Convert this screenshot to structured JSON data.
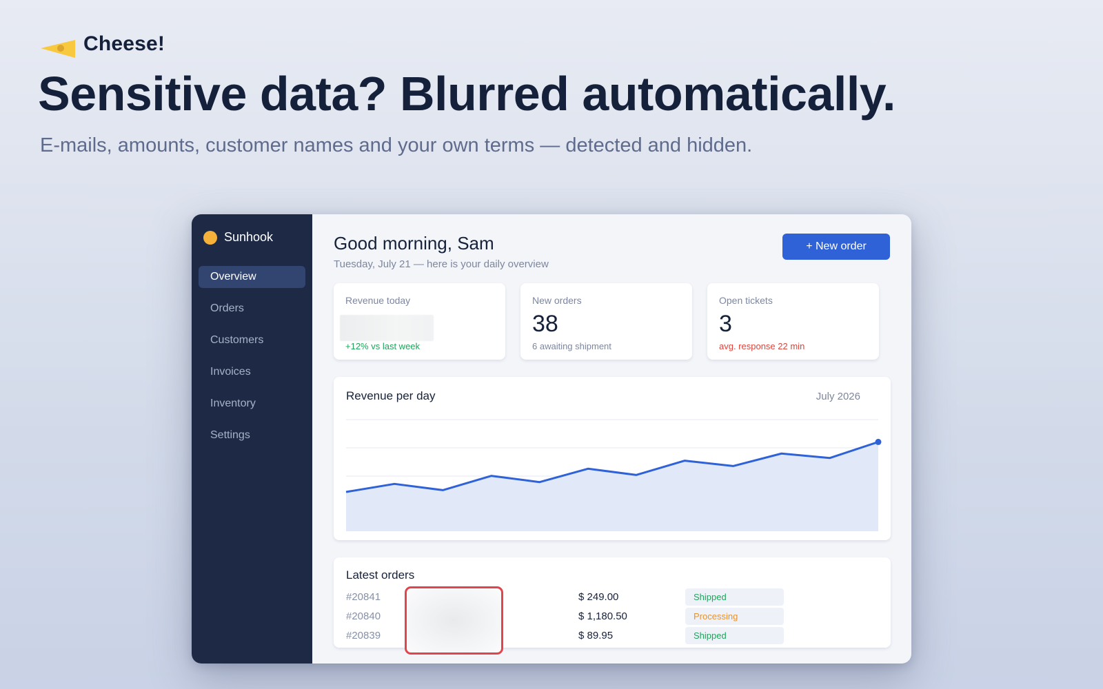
{
  "brand": {
    "name": "Cheese!",
    "logo_icon": "cheese-wedge-icon",
    "logo_color": "#f8c93f"
  },
  "hero": {
    "title": "Sensitive data? Blurred automatically.",
    "subtitle": "E-mails, amounts, customer names and your own terms — detected and hidden."
  },
  "app": {
    "name": "Sunhook",
    "logo_color": "#f6b13b",
    "nav": [
      {
        "label": "Overview",
        "active": true
      },
      {
        "label": "Orders",
        "active": false
      },
      {
        "label": "Customers",
        "active": false
      },
      {
        "label": "Invoices",
        "active": false
      },
      {
        "label": "Inventory",
        "active": false
      },
      {
        "label": "Settings",
        "active": false
      }
    ],
    "greeting": "Good morning, Sam",
    "date_line": "Tuesday, July 21 — here is your daily overview",
    "new_order_label": "+ New order",
    "stats": [
      {
        "label": "Revenue today",
        "value": "",
        "note": "+12% vs last week",
        "note_color": "#1fa35c",
        "blurred": true
      },
      {
        "label": "New orders",
        "value": "38",
        "note": "6 awaiting shipment",
        "note_color": "#7c869e",
        "blurred": false
      },
      {
        "label": "Open tickets",
        "value": "3",
        "note": "avg. response 22 min",
        "note_color": "#d9453c",
        "blurred": false
      }
    ],
    "chart": {
      "title": "Revenue per day",
      "period": "July 2026"
    },
    "orders": {
      "title": "Latest orders",
      "rows": [
        {
          "id": "#20841",
          "amount": "$ 249.00",
          "status": "Shipped",
          "status_color": "#1fa35c"
        },
        {
          "id": "#20840",
          "amount": "$ 1,180.50",
          "status": "Processing",
          "status_color": "#e8922d"
        },
        {
          "id": "#20839",
          "amount": "$ 89.95",
          "status": "Shipped",
          "status_color": "#1fa35c"
        }
      ]
    }
  },
  "chart_data": {
    "type": "area",
    "title": "Revenue per day",
    "x": [
      1,
      2,
      3,
      4,
      5,
      6,
      7,
      8,
      9,
      10,
      11,
      12
    ],
    "values": [
      44,
      53,
      46,
      62,
      55,
      70,
      63,
      79,
      73,
      87,
      82,
      100
    ],
    "ylim": [
      0,
      125
    ],
    "grid": true,
    "line_color": "#2f62d6",
    "fill_color": "#e1e9f8"
  }
}
